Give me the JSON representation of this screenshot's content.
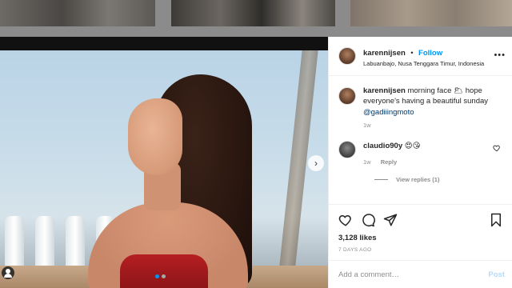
{
  "post": {
    "username": "karennijsen",
    "follow_label": "Follow",
    "bullet": "•",
    "location": "Labuanbajo, Nusa Tenggara Timur, Indonesia",
    "more_icon": "more-horizontal-icon",
    "caption": {
      "username": "karennijsen",
      "text": " morning face 🌥 hope everyone's having a beautiful sunday ",
      "mention": "@gadiiingmoto",
      "time": "1w"
    },
    "comments": [
      {
        "username": "claudio90y",
        "text": " 😍😘",
        "time": "1w",
        "reply_label": "Reply",
        "view_replies": "View replies (1)"
      }
    ],
    "likes": "3,128 likes",
    "date": "7 DAYS AGO",
    "add_comment_placeholder": "Add a comment…",
    "post_label": "Post"
  },
  "carousel": {
    "current": 1,
    "total": 2,
    "next_icon": "chevron-right-icon"
  },
  "colors": {
    "accent": "#0095f6",
    "dress": "#b51f22"
  }
}
